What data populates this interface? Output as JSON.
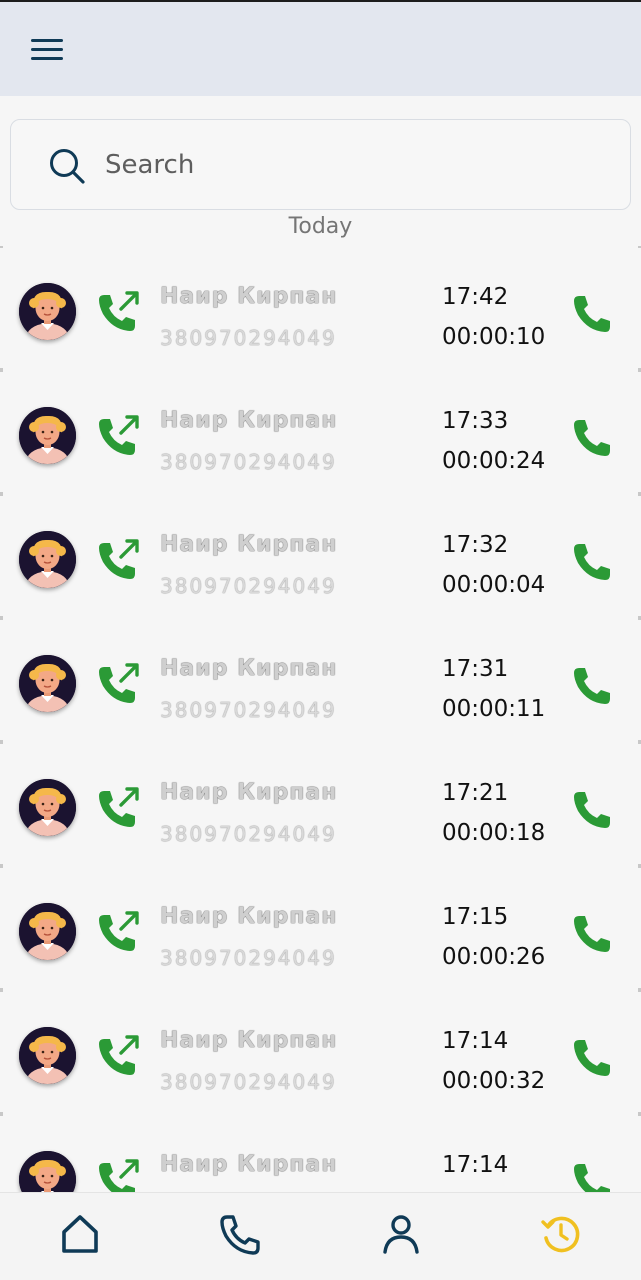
{
  "appbar": {
    "menu_icon": "hamburger-menu-icon"
  },
  "search": {
    "placeholder": "Search",
    "icon": "search-icon"
  },
  "section_label": "Today",
  "calls": [
    {
      "name": "Наир Кирпан",
      "number": "380970294049",
      "time": "17:42",
      "duration": "00:00:10"
    },
    {
      "name": "Наир Кирпан",
      "number": "380970294049",
      "time": "17:33",
      "duration": "00:00:24"
    },
    {
      "name": "Наир Кирпан",
      "number": "380970294049",
      "time": "17:32",
      "duration": "00:00:04"
    },
    {
      "name": "Наир Кирпан",
      "number": "380970294049",
      "time": "17:31",
      "duration": "00:00:11"
    },
    {
      "name": "Наир Кирпан",
      "number": "380970294049",
      "time": "17:21",
      "duration": "00:00:18"
    },
    {
      "name": "Наир Кирпан",
      "number": "380970294049",
      "time": "17:15",
      "duration": "00:00:26"
    },
    {
      "name": "Наир Кирпан",
      "number": "380970294049",
      "time": "17:14",
      "duration": "00:00:32"
    },
    {
      "name": "Наир Кирпан",
      "number": "",
      "time": "17:14",
      "duration": ""
    }
  ],
  "bottom_nav": [
    {
      "icon": "home-icon",
      "active": false
    },
    {
      "icon": "phone-icon",
      "active": false
    },
    {
      "icon": "contacts-icon",
      "active": false
    },
    {
      "icon": "history-icon",
      "active": true
    }
  ],
  "colors": {
    "appbar_bg": "#e3e7ef",
    "call_green": "#2b9a36",
    "nav_dark": "#0f3a56",
    "nav_active": "#f0c020"
  }
}
